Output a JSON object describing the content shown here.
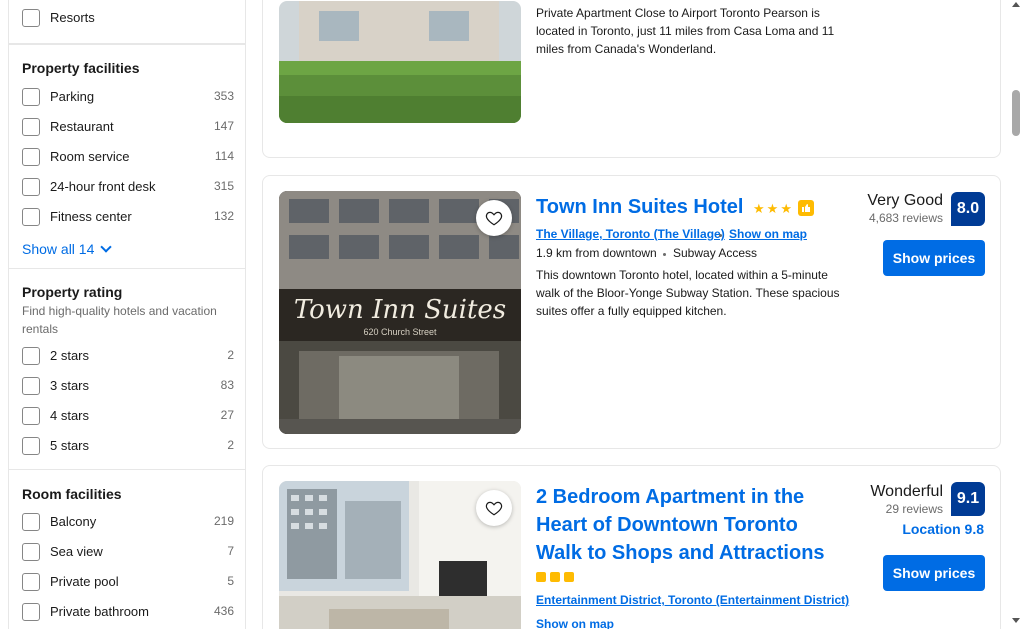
{
  "filters": {
    "resorts": {
      "label": "Resorts",
      "count": ""
    },
    "property_facilities": {
      "title": "Property facilities",
      "items": [
        {
          "label": "Parking",
          "count": "353"
        },
        {
          "label": "Restaurant",
          "count": "147"
        },
        {
          "label": "Room service",
          "count": "114"
        },
        {
          "label": "24-hour front desk",
          "count": "315"
        },
        {
          "label": "Fitness center",
          "count": "132"
        }
      ],
      "show_all": "Show all 14"
    },
    "property_rating": {
      "title": "Property rating",
      "subtitle": "Find high-quality hotels and vacation rentals",
      "items": [
        {
          "label": "2 stars",
          "count": "2"
        },
        {
          "label": "3 stars",
          "count": "83"
        },
        {
          "label": "4 stars",
          "count": "27"
        },
        {
          "label": "5 stars",
          "count": "2"
        }
      ]
    },
    "room_facilities": {
      "title": "Room facilities",
      "items": [
        {
          "label": "Balcony",
          "count": "219"
        },
        {
          "label": "Sea view",
          "count": "7"
        },
        {
          "label": "Private pool",
          "count": "5"
        },
        {
          "label": "Private bathroom",
          "count": "436"
        }
      ]
    }
  },
  "results": [
    {
      "description": "Private Apartment Close to Airport Toronto Pearson is located in Toronto, just 11 miles from Casa Loma and 11 miles from Canada's Wonderland."
    },
    {
      "name": "Town Inn Suites Hotel",
      "stars": 3,
      "location": "The Village, Toronto (The Village)",
      "show_on_map": "Show on map",
      "distance": "1.9 km from downtown",
      "transit": "Subway Access",
      "description": "This downtown Toronto hotel, located within a 5-minute walk of the Bloor-Yonge Subway Station. These spacious suites offer a fully equipped kitchen.",
      "sign_text": "Town Inn Suites",
      "sign_address": "620 Church Street",
      "score_word": "Very Good",
      "reviews": "4,683 reviews",
      "score": "8.0",
      "button": "Show prices"
    },
    {
      "name_lines": [
        "2 Bedroom Apartment in the",
        "Heart of Downtown Toronto",
        "Walk to Shops and Attractions"
      ],
      "location": "Entertainment District, Toronto (Entertainment District)",
      "show_on_map": "Show on map",
      "score_word": "Wonderful",
      "reviews": "29 reviews",
      "score": "9.1",
      "location_score": "Location 9.8",
      "button": "Show prices"
    }
  ],
  "colors": {
    "brand_blue": "#006ce4",
    "score_navy": "#003b95",
    "gold": "#febb02"
  }
}
